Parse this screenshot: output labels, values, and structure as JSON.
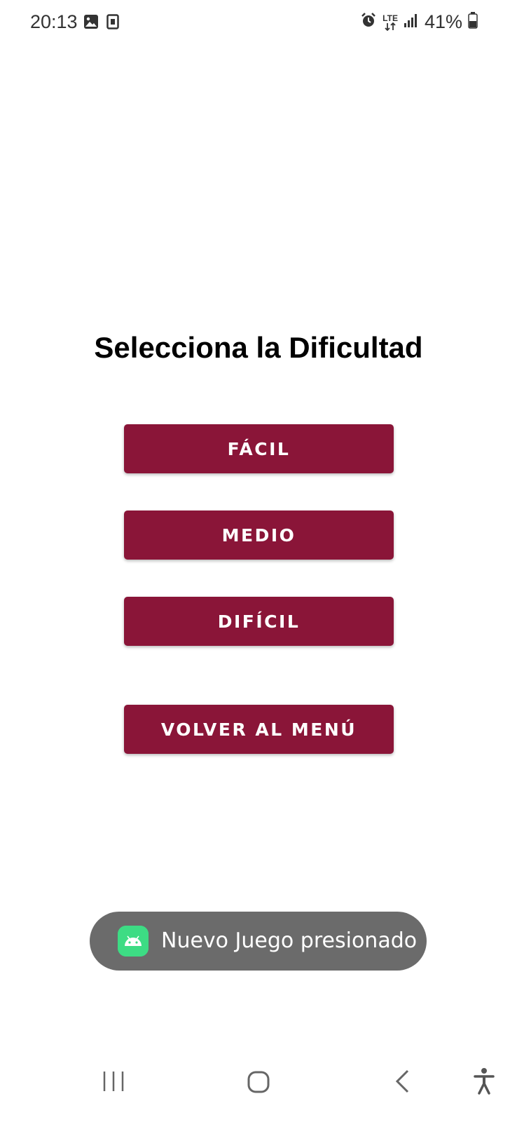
{
  "status_bar": {
    "time": "20:13",
    "network": "LTE",
    "battery": "41%"
  },
  "screen": {
    "title": "Selecciona la Dificultad"
  },
  "buttons": {
    "facil": "FÁCIL",
    "medio": "MEDIO",
    "dificil": "DIFÍCIL",
    "volver": "VOLVER AL MENÚ"
  },
  "toast": {
    "message": "Nuevo Juego presionado"
  },
  "colors": {
    "accent": "#8a1538",
    "toast_bg": "#6b6b6b",
    "android_green": "#3ddc84"
  },
  "icons": {
    "status_left": [
      "gallery-icon",
      "sim-card-icon"
    ],
    "status_right": [
      "alarm-icon",
      "lte-icon",
      "signal-icon",
      "battery-icon"
    ],
    "nav": [
      "recents-icon",
      "home-icon",
      "back-icon",
      "accessibility-icon"
    ]
  }
}
